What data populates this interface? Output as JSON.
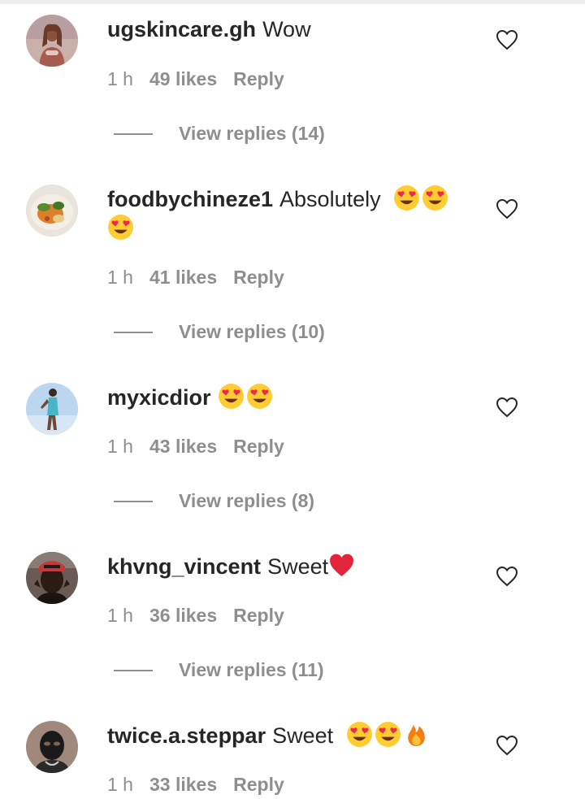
{
  "comments": [
    {
      "username": "ugskincare.gh",
      "text": "Wow",
      "emoji": [],
      "time": "1 h",
      "likes": "49 likes",
      "reply": "Reply",
      "view_replies": "View replies (14)",
      "avatar": "woman-portrait-avatar"
    },
    {
      "username": "foodbychineze1",
      "text": "Absolutely",
      "emoji": [
        "heart-eyes-emoji",
        "heart-eyes-emoji",
        "heart-eyes-emoji"
      ],
      "time": "1 h",
      "likes": "41 likes",
      "reply": "Reply",
      "view_replies": "View replies (10)",
      "avatar": "food-plate-avatar"
    },
    {
      "username": "myxicdior",
      "text": "",
      "emoji": [
        "heart-eyes-emoji",
        "heart-eyes-emoji"
      ],
      "time": "1 h",
      "likes": "43 likes",
      "reply": "Reply",
      "view_replies": "View replies (8)",
      "avatar": "woman-standing-avatar"
    },
    {
      "username": "khvng_vincent",
      "text": "Sweet",
      "emoji": [
        "red-heart-emoji"
      ],
      "time": "1 h",
      "likes": "36 likes",
      "reply": "Reply",
      "view_replies": "View replies (11)",
      "avatar": "man-portrait-avatar"
    },
    {
      "username": "twice.a.steppar",
      "text": "Sweet",
      "emoji": [
        "heart-eyes-emoji",
        "heart-eyes-emoji",
        "fire-emoji"
      ],
      "time": "1 h",
      "likes": "33 likes",
      "reply": "Reply",
      "view_replies": "",
      "avatar": "masked-man-avatar"
    }
  ],
  "colors": {
    "text": "#262626",
    "meta": "#8e8e8e",
    "emoji_face": "#ffcc33",
    "emoji_heart": "#ed2a4a"
  }
}
